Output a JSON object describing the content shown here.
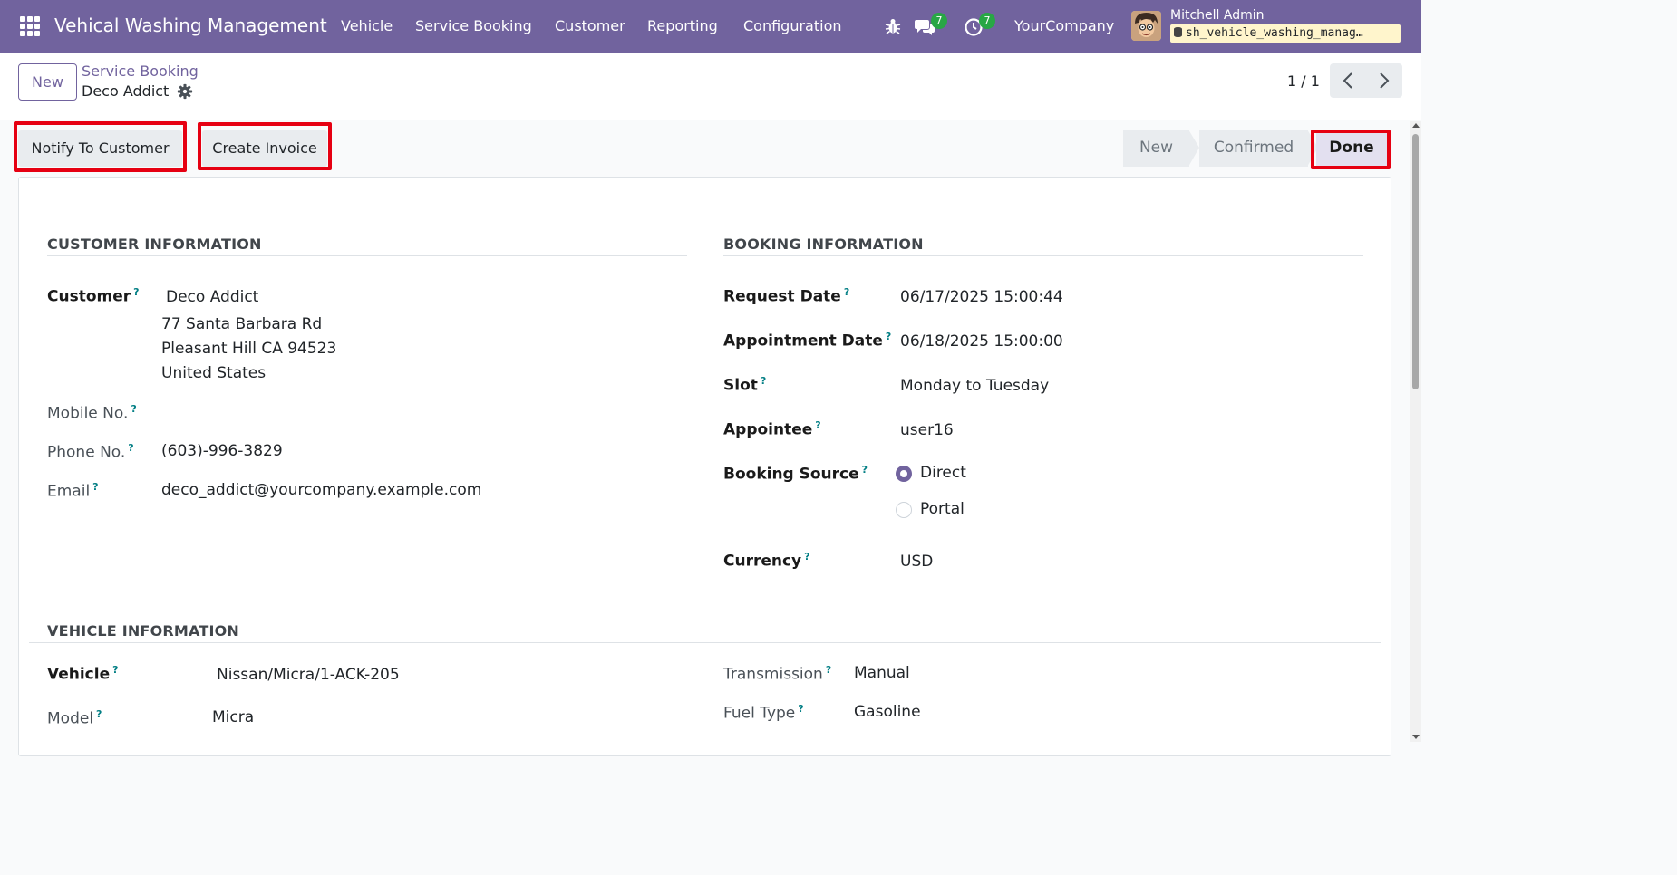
{
  "navbar": {
    "app_title": "Vehical Washing Management",
    "menu": [
      "Vehicle",
      "Service Booking",
      "Customer",
      "Reporting",
      "Configuration"
    ],
    "messages_count": "7",
    "activities_count": "7",
    "company": "YourCompany",
    "user_name": "Mitchell Admin",
    "database": "sh_vehicle_washing_manag…"
  },
  "control_panel": {
    "new_label": "New",
    "breadcrumb_parent": "Service Booking",
    "breadcrumb_current": "Deco Addict",
    "pager": "1 / 1"
  },
  "actions": {
    "notify": "Notify To Customer",
    "invoice": "Create Invoice"
  },
  "stages": {
    "items": [
      "New",
      "Confirmed",
      "Done"
    ],
    "current": "Done"
  },
  "customer_info": {
    "title": "CUSTOMER INFORMATION",
    "customer_label": "Customer",
    "customer_name": "Deco Addict",
    "address_line1": "77 Santa Barbara Rd",
    "address_line2": "Pleasant Hill CA 94523",
    "address_line3": "United States",
    "mobile_label": "Mobile No.",
    "mobile_value": "",
    "phone_label": "Phone No.",
    "phone_value": "(603)-996-3829",
    "email_label": "Email",
    "email_value": "deco_addict@yourcompany.example.com"
  },
  "booking_info": {
    "title": "BOOKING INFORMATION",
    "request_date_label": "Request Date",
    "request_date_value": "06/17/2025 15:00:44",
    "appointment_date_label": "Appointment Date",
    "appointment_date_value": "06/18/2025 15:00:00",
    "slot_label": "Slot",
    "slot_value": "Monday to Tuesday",
    "appointee_label": "Appointee",
    "appointee_value": "user16",
    "booking_source_label": "Booking Source",
    "source_options": [
      "Direct",
      "Portal"
    ],
    "source_selected": "Direct",
    "currency_label": "Currency",
    "currency_value": "USD"
  },
  "vehicle_info": {
    "title": "VEHICLE INFORMATION",
    "vehicle_label": "Vehicle",
    "vehicle_value": "Nissan/Micra/1-ACK-205",
    "model_label": "Model",
    "model_value": "Micra",
    "transmission_label": "Transmission",
    "transmission_value": "Manual",
    "fuel_label": "Fuel Type",
    "fuel_value": "Gasoline"
  },
  "help_marker": "?",
  "colors": {
    "navbar": "#71639e",
    "highlight": "#e60012",
    "badge": "#28a745",
    "help": "#017e84"
  }
}
